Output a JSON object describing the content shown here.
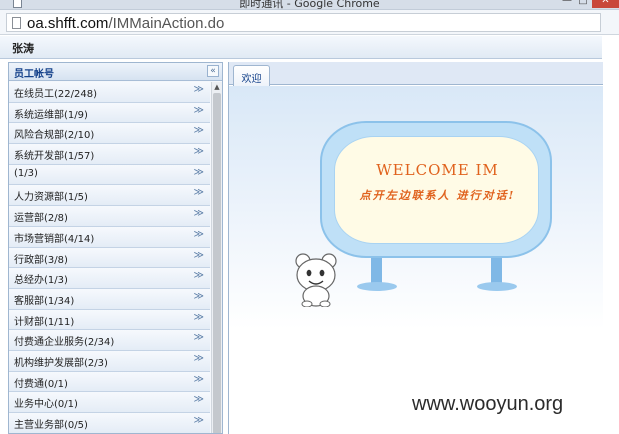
{
  "window": {
    "title": "即时通讯 - Google Chrome",
    "minimize": "—",
    "maximize": "□",
    "close": "✕"
  },
  "address": {
    "host": "oa.shfft.com",
    "path": "/IMMainAction.do"
  },
  "user": {
    "name": "张涛"
  },
  "sidebar": {
    "title": "员工帐号",
    "collapse": "«",
    "scroll_up": "▲",
    "groups": [
      {
        "label": "在线员工(22/248)"
      },
      {
        "label": "系统运维部(1/9)"
      },
      {
        "label": "风险合规部(2/10)"
      },
      {
        "label": "系统开发部(1/57)"
      },
      {
        "label": "(1/3)"
      },
      {
        "label": "人力资源部(1/5)"
      },
      {
        "label": "运营部(2/8)"
      },
      {
        "label": "市场营销部(4/14)"
      },
      {
        "label": "行政部(3/8)"
      },
      {
        "label": "总经办(1/3)"
      },
      {
        "label": "客服部(1/34)"
      },
      {
        "label": "计财部(1/11)"
      },
      {
        "label": "付费通企业服务(2/34)"
      },
      {
        "label": "机构维护发展部(2/3)"
      },
      {
        "label": "付费通(0/1)"
      },
      {
        "label": "业务中心(0/1)"
      },
      {
        "label": "主营业务部(0/5)"
      }
    ],
    "expand_icon": "≫"
  },
  "main": {
    "tab_label": "欢迎",
    "welcome_title": "WELCOME IM",
    "welcome_sub": "点开左边联系人 进行对话!"
  },
  "watermark": "www.wooyun.org"
}
